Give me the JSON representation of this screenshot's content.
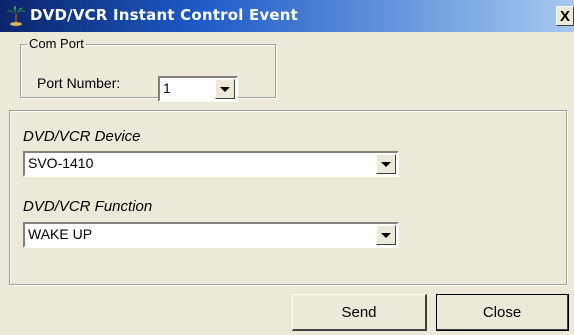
{
  "window": {
    "title": "DVD/VCR Instant Control Event",
    "close_glyph": "X"
  },
  "com_port": {
    "legend": "Com Port",
    "port_label": "Port Number:",
    "port_value": "1"
  },
  "device": {
    "label": "DVD/VCR Device",
    "value": "SVO-1410"
  },
  "function": {
    "label": "DVD/VCR Function",
    "value": "WAKE UP"
  },
  "buttons": {
    "send": "Send",
    "close": "Close"
  },
  "icons": {
    "app": "palm-tree-icon",
    "dropdown": "chevron-down-icon"
  }
}
